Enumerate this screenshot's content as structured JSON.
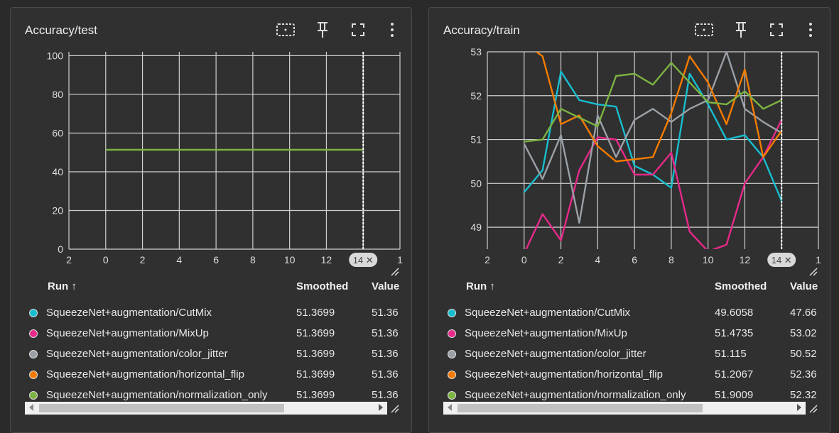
{
  "colors": {
    "CutMix": "#17becf",
    "MixUp": "#e7298a",
    "color_jitter": "#9aa0a6",
    "horizontal_flip": "#f57c00",
    "normalization_only": "#7cb342"
  },
  "icons": [
    "fit-domain-icon",
    "pin-icon",
    "fullscreen-icon",
    "more-vert-icon",
    "sort-arrow-icon",
    "close-icon",
    "resize-handle-icon"
  ],
  "table_headers": {
    "run": "Run ↑",
    "smoothed": "Smoothed",
    "value": "Value"
  },
  "panels": [
    {
      "title": "Accuracy/test",
      "step_badge": "14 ✕",
      "rows": [
        {
          "run": "SqueezeNet+augmentation/CutMix",
          "smoothed": "51.3699",
          "value": "51.36",
          "color": "#17becf"
        },
        {
          "run": "SqueezeNet+augmentation/MixUp",
          "smoothed": "51.3699",
          "value": "51.36",
          "color": "#e7298a"
        },
        {
          "run": "SqueezeNet+augmentation/color_jitter",
          "smoothed": "51.3699",
          "value": "51.36",
          "color": "#9aa0a6"
        },
        {
          "run": "SqueezeNet+augmentation/horizontal_flip",
          "smoothed": "51.3699",
          "value": "51.36",
          "color": "#f57c00"
        },
        {
          "run": "SqueezeNet+augmentation/normalization_only",
          "smoothed": "51.3699",
          "value": "51.36",
          "color": "#7cb342"
        }
      ],
      "chart_data": {
        "type": "line",
        "title": "Accuracy/test",
        "xlim": [
          -2,
          16
        ],
        "ylim": [
          0,
          102
        ],
        "x_ticks": [
          -2,
          0,
          2,
          4,
          6,
          8,
          10,
          12,
          14,
          16
        ],
        "x_tick_labels": [
          "2",
          "0",
          "2",
          "4",
          "6",
          "8",
          "10",
          "12",
          "",
          "1"
        ],
        "y_ticks": [
          0,
          20,
          40,
          60,
          80,
          100
        ],
        "y_tick_labels": [
          "0",
          "20",
          "40",
          "60",
          "80",
          "100"
        ],
        "cursor_x": 14,
        "series": [
          {
            "run": "normalization_only",
            "color": "#7cb342",
            "x": [
              0,
              14
            ],
            "y": [
              51.37,
              51.37
            ]
          }
        ]
      }
    },
    {
      "title": "Accuracy/train",
      "step_badge": "14 ✕",
      "rows": [
        {
          "run": "SqueezeNet+augmentation/CutMix",
          "smoothed": "49.6058",
          "value": "47.66",
          "color": "#17becf"
        },
        {
          "run": "SqueezeNet+augmentation/MixUp",
          "smoothed": "51.4735",
          "value": "53.02",
          "color": "#e7298a"
        },
        {
          "run": "SqueezeNet+augmentation/color_jitter",
          "smoothed": "51.115",
          "value": "50.52",
          "color": "#9aa0a6"
        },
        {
          "run": "SqueezeNet+augmentation/horizontal_flip",
          "smoothed": "51.2067",
          "value": "52.36",
          "color": "#f57c00"
        },
        {
          "run": "SqueezeNet+augmentation/normalization_only",
          "smoothed": "51.9009",
          "value": "52.32",
          "color": "#7cb342"
        }
      ],
      "chart_data": {
        "type": "line",
        "title": "Accuracy/train",
        "xlim": [
          -2,
          16
        ],
        "ylim": [
          48.5,
          53
        ],
        "x_ticks": [
          -2,
          0,
          2,
          4,
          6,
          8,
          10,
          12,
          14,
          16
        ],
        "x_tick_labels": [
          "2",
          "0",
          "2",
          "4",
          "6",
          "8",
          "10",
          "12",
          "",
          "1"
        ],
        "y_ticks": [
          49,
          50,
          51,
          52,
          53
        ],
        "y_tick_labels": [
          "49",
          "50",
          "51",
          "52",
          "53"
        ],
        "cursor_x": 14,
        "series": [
          {
            "run": "CutMix",
            "color": "#17becf",
            "x": [
              0,
              1,
              2,
              3,
              4,
              5,
              6,
              7,
              8,
              9,
              10,
              11,
              12,
              13,
              14
            ],
            "y": [
              49.8,
              50.3,
              52.55,
              51.9,
              51.8,
              51.75,
              50.4,
              50.2,
              49.9,
              52.5,
              51.8,
              51.0,
              51.1,
              50.6,
              49.6
            ]
          },
          {
            "run": "MixUp",
            "color": "#e7298a",
            "x": [
              0,
              1,
              2,
              3,
              4,
              5,
              6,
              7,
              8,
              9,
              10,
              11,
              12,
              13,
              14
            ],
            "y": [
              48.4,
              49.3,
              48.7,
              50.3,
              51.05,
              51.0,
              50.2,
              50.2,
              50.7,
              48.9,
              48.45,
              48.6,
              50.0,
              50.6,
              51.45
            ]
          },
          {
            "run": "color_jitter",
            "color": "#9aa0a6",
            "x": [
              0,
              1,
              2,
              3,
              4,
              5,
              6,
              7,
              8,
              9,
              10,
              11,
              12,
              13,
              14
            ],
            "y": [
              50.9,
              50.1,
              51.1,
              49.1,
              51.55,
              50.6,
              51.45,
              51.7,
              51.4,
              51.7,
              51.9,
              53.0,
              51.7,
              51.4,
              51.15
            ]
          },
          {
            "run": "horizontal_flip",
            "color": "#f57c00",
            "x": [
              0,
              1,
              2,
              3,
              4,
              5,
              6,
              7,
              8,
              9,
              10,
              11,
              12,
              13,
              14
            ],
            "y": [
              53.2,
              52.9,
              51.35,
              51.55,
              50.85,
              50.5,
              50.55,
              50.6,
              51.6,
              52.9,
              52.3,
              51.35,
              52.6,
              50.6,
              51.2
            ]
          },
          {
            "run": "normalization_only",
            "color": "#7cb342",
            "x": [
              0,
              1,
              2,
              3,
              4,
              5,
              6,
              7,
              8,
              9,
              10,
              11,
              12,
              13,
              14
            ],
            "y": [
              50.95,
              51.0,
              51.7,
              51.5,
              51.3,
              52.45,
              52.5,
              52.25,
              52.75,
              52.3,
              51.85,
              51.8,
              52.1,
              51.7,
              51.9
            ]
          }
        ]
      }
    }
  ]
}
